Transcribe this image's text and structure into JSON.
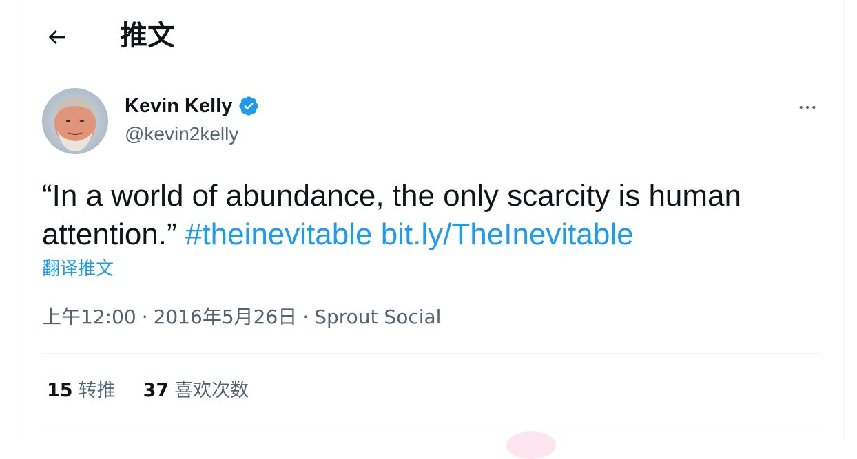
{
  "header": {
    "title": "推文"
  },
  "author": {
    "display_name": "Kevin Kelly",
    "handle": "@kevin2kelly",
    "verified": true
  },
  "tweet": {
    "text": "“In a world of abundance, the only scarcity is human attention.”",
    "hashtag": "#theinevitable",
    "link": "bit.ly/TheInevitable",
    "translate_label": "翻译推文"
  },
  "meta": {
    "time": "上午12:00",
    "date": "2016年5月26日",
    "separator": "·",
    "source": "Sprout Social"
  },
  "stats": {
    "retweets_count": "15",
    "retweets_label": "转推",
    "likes_count": "37",
    "likes_label": "喜欢次数"
  },
  "colors": {
    "accent": "#1d9bf0",
    "text_primary": "#0f1419",
    "text_secondary": "#536471",
    "divider": "#eff3f4"
  },
  "icons": {
    "back": "arrow-left-icon",
    "verified": "verified-badge-icon",
    "more": "more-horizontal-icon"
  }
}
